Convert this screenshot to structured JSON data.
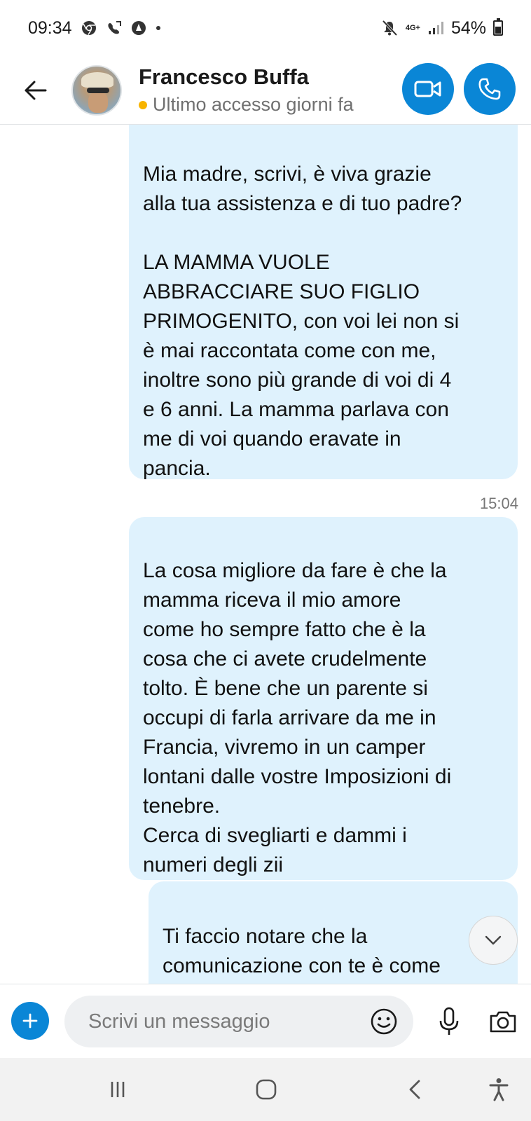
{
  "status_bar": {
    "time": "09:34",
    "network": "4G+",
    "battery": "54%",
    "battery_level": 0.54,
    "icons": [
      "chrome-icon",
      "call-forward-icon",
      "notification-icon",
      "dot-icon",
      "mute-icon",
      "signal-icon",
      "battery-icon"
    ]
  },
  "header": {
    "contact_name": "Francesco Buffa",
    "last_seen": "Ultimo accesso giorni fa",
    "presence_color": "#f8b400",
    "accent_color": "#0a86d6",
    "icons": [
      "back-arrow-icon",
      "avatar",
      "video-call-icon",
      "phone-icon"
    ]
  },
  "messages": [
    {
      "text": "Mia madre, scrivi, è viva grazie\nalla tua assistenza e di tuo padre?\n\nLA MAMMA VUOLE\nABBRACCIARE SUO FIGLIO\nPRIMOGENITO, con voi lei non si\nè mai raccontata come con me,\ninoltre sono più grande di voi di 4\ne 6 anni. La mamma parlava con\nme di voi quando eravate in\npancia."
    },
    {
      "timestamp": "15:04",
      "text": "La cosa migliore da fare è che la\nmamma riceva il mio amore\ncome ho sempre fatto che è la\ncosa che ci avete crudelmente\ntolto. È bene che un parente si\noccupi di farla arrivare da me in\nFrancia, vivremo in un camper\nlontani dalle vostre Imposizioni di\ntenebre.\nCerca di svegliarti e dammi i\nnumeri degli zii"
    },
    {
      "text": "Ti faccio notare che la\ncomunicazione con te è come\nricevere coltellate, ma questo lo"
    }
  ],
  "bubble_color": "#dff2fd",
  "composer": {
    "placeholder": "Scrivi un messaggio",
    "icons": [
      "add-icon",
      "emoji-icon",
      "microphone-icon",
      "camera-icon",
      "chevron-down-icon"
    ]
  },
  "nav_bar": {
    "icons": [
      "recents-icon",
      "home-icon",
      "back-icon",
      "accessibility-icon"
    ]
  }
}
